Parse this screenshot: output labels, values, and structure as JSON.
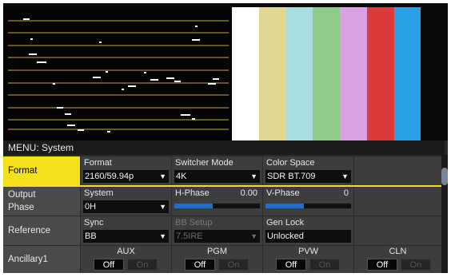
{
  "menu_title": "MENU: System",
  "color_bars": [
    "#ffffff",
    "#e0d890",
    "#a8dde0",
    "#8ccc88",
    "#dca0e4",
    "#dd3a3a",
    "#2aa0e8",
    "#0a0a0a"
  ],
  "rows": {
    "format": {
      "label": "Format",
      "format": {
        "label": "Format",
        "value": "2160/59.94p"
      },
      "switcher_mode": {
        "label": "Switcher Mode",
        "value": "4K"
      },
      "color_space": {
        "label": "Color Space",
        "value": "SDR BT.709"
      }
    },
    "output_phase": {
      "label_line1": "Output",
      "label_line2": "Phase",
      "system": {
        "label": "System",
        "value": "0H"
      },
      "h_phase": {
        "label": "H-Phase",
        "value": "0.00",
        "level": 0.45
      },
      "v_phase": {
        "label": "V-Phase",
        "value": "0",
        "level": 0.45
      }
    },
    "reference": {
      "label": "Reference",
      "sync": {
        "label": "Sync",
        "value": "BB"
      },
      "bb_setup": {
        "label": "BB Setup",
        "value": "7.5IRE"
      },
      "gen_lock": {
        "label": "Gen Lock",
        "value": "Unlocked"
      }
    },
    "ancillary": {
      "label": "Ancillary1",
      "toggles": [
        {
          "name": "AUX",
          "off": "Off",
          "on": "On"
        },
        {
          "name": "PGM",
          "off": "Off",
          "on": "On"
        },
        {
          "name": "PVW",
          "off": "Off",
          "on": "On"
        },
        {
          "name": "CLN",
          "off": "Off",
          "on": "On"
        }
      ]
    }
  },
  "icons": {
    "dropdown": "triangle-down"
  },
  "colors": {
    "accent": "#f3e11c",
    "slider": "#1f6fd1"
  }
}
